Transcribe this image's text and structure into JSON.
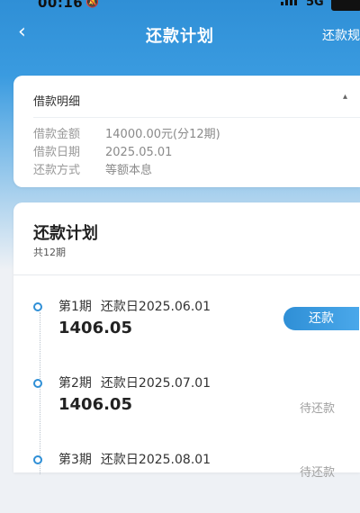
{
  "status_bar": {
    "time": "00:16",
    "network": "5G"
  },
  "nav": {
    "title": "还款计划",
    "right_link": "还款规"
  },
  "loan_detail": {
    "header": "借款明细",
    "rows": [
      {
        "label": "借款金额",
        "value": "14000.00元(分12期)"
      },
      {
        "label": "借款日期",
        "value": "2025.05.01"
      },
      {
        "label": "还款方式",
        "value": "等额本息"
      }
    ]
  },
  "plan": {
    "title": "还款计划",
    "subtitle": "共12期",
    "items": [
      {
        "period": "第1期",
        "due": "还款日2025.06.01",
        "amount": "1406.05",
        "action": "还款"
      },
      {
        "period": "第2期",
        "due": "还款日2025.07.01",
        "amount": "1406.05",
        "status": "待还款"
      },
      {
        "period": "第3期",
        "due": "还款日2025.08.01",
        "amount": "",
        "status": "待还款"
      }
    ]
  },
  "colors": {
    "accent": "#2f8fd6",
    "background": "#eef1f5"
  },
  "icons": {
    "back": "chevron-left-icon",
    "collapse": "caret-up-icon"
  }
}
